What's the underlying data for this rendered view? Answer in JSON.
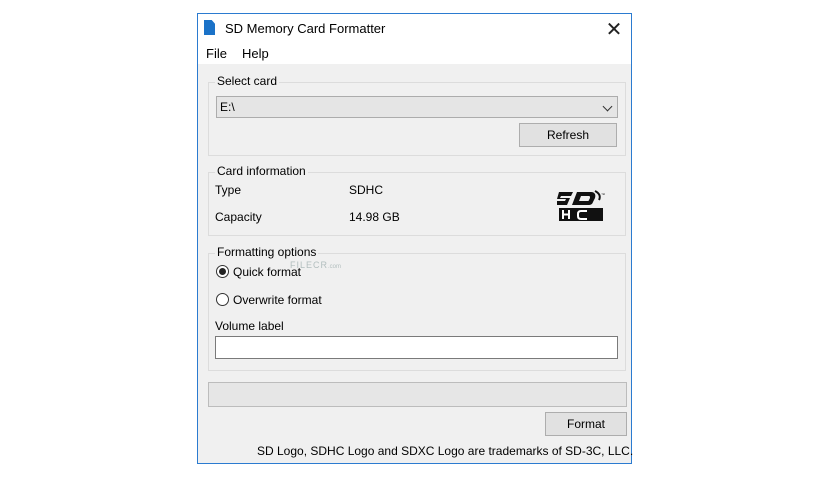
{
  "window": {
    "title": "SD Memory Card Formatter",
    "close_glyph": "✕"
  },
  "menu": {
    "items": [
      "File",
      "Help"
    ]
  },
  "select_card": {
    "group_title": "Select card",
    "selected_drive": "E:\\",
    "refresh_label": "Refresh"
  },
  "card_info": {
    "group_title": "Card information",
    "type_label": "Type",
    "type_value": "SDHC",
    "capacity_label": "Capacity",
    "capacity_value": "14.98 GB"
  },
  "formatting": {
    "group_title": "Formatting options",
    "quick_label": "Quick format",
    "overwrite_label": "Overwrite format",
    "selected": "quick",
    "volume_label_caption": "Volume label",
    "volume_label_value": ""
  },
  "progress": {
    "fraction": 0
  },
  "actions": {
    "format_label": "Format"
  },
  "footer": {
    "trademark_text": "SD Logo, SDHC Logo and SDXC Logo are trademarks of SD-3C, LLC."
  },
  "watermark": {
    "text": "FILECR",
    "suffix": ".com"
  },
  "colors": {
    "window_border": "#2b7bd0",
    "app_icon": "#1a72c8"
  }
}
